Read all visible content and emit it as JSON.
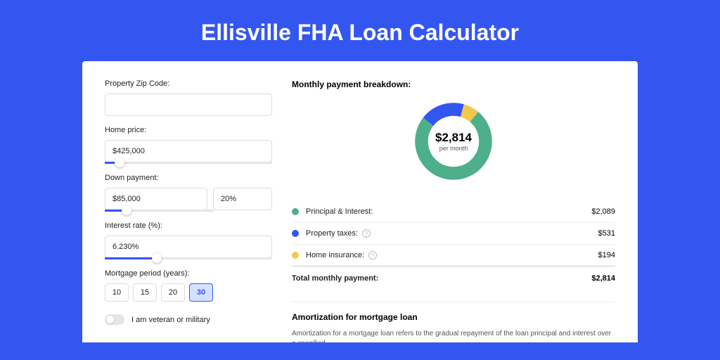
{
  "title": "Ellisville FHA Loan Calculator",
  "form": {
    "zip_label": "Property Zip Code:",
    "zip_value": "",
    "price_label": "Home price:",
    "price_value": "$425,000",
    "price_slider_pct": 9,
    "down_label": "Down payment:",
    "down_value": "$85,000",
    "down_pct_value": "20%",
    "down_slider_pct": 20,
    "rate_label": "Interest rate (%):",
    "rate_value": "6.230%",
    "rate_slider_pct": 31,
    "period_label": "Mortgage period (years):",
    "periods": [
      "10",
      "15",
      "20",
      "30"
    ],
    "period_active": 3,
    "veteran_label": "I am veteran or military"
  },
  "breakdown": {
    "title": "Monthly payment breakdown:",
    "amount": "$2,814",
    "sub": "per month",
    "items": [
      {
        "label": "Principal & Interest:",
        "value": "$2,089",
        "color": "#4db08a",
        "help": false
      },
      {
        "label": "Property taxes:",
        "value": "$531",
        "color": "#3456f0",
        "help": true
      },
      {
        "label": "Home insurance:",
        "value": "$194",
        "color": "#f2c94c",
        "help": true
      }
    ],
    "total_label": "Total monthly payment:",
    "total_value": "$2,814"
  },
  "chart_data": {
    "type": "pie",
    "title": "Monthly payment breakdown",
    "series": [
      {
        "name": "Principal & Interest",
        "value": 2089,
        "color": "#4db08a"
      },
      {
        "name": "Property taxes",
        "value": 531,
        "color": "#3456f0"
      },
      {
        "name": "Home insurance",
        "value": 194,
        "color": "#f2c94c"
      }
    ],
    "total": 2814
  },
  "amort": {
    "title": "Amortization for mortgage loan",
    "text": "Amortization for a mortgage loan refers to the gradual repayment of the loan principal and interest over a specified"
  }
}
